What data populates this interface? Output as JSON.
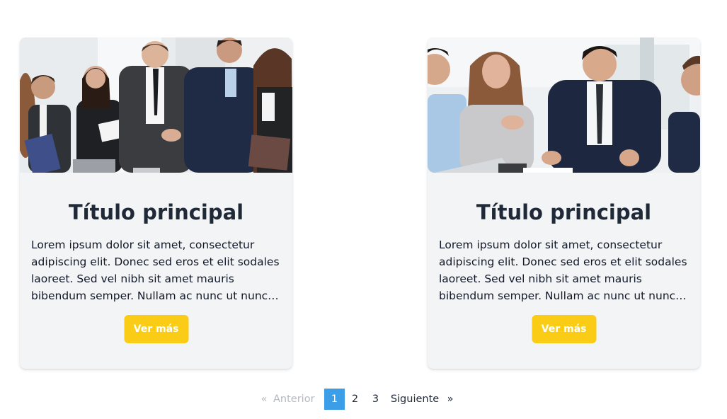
{
  "cards": [
    {
      "title": "Título principal",
      "text": "Lorem ipsum dolor sit amet, consectetur adipiscing elit. Donec sed eros et elit sodales laoreet. Sed vel nibh sit amet mauris bibendum semper. Nullam ac nunc ut nunc eleifend ultricies.",
      "button": "Ver más",
      "image": "business-handshake-photo"
    },
    {
      "title": "Título principal",
      "text": "Lorem ipsum dolor sit amet, consectetur adipiscing elit. Donec sed eros et elit sodales laoreet. Sed vel nibh sit amet mauris bibendum semper. Nullam ac nunc ut nunc eleifend ultricies.",
      "button": "Ver más",
      "image": "business-meeting-photo"
    }
  ],
  "pagination": {
    "prev_arrow": "«",
    "prev_label": "Anterior",
    "pages": [
      "1",
      "2",
      "3"
    ],
    "current_page": "1",
    "next_label": "Siguiente",
    "next_arrow": "»"
  },
  "colors": {
    "card_bg": "#f3f4f6",
    "button_bg": "#facc15",
    "active_page_bg": "#3b9ee6",
    "title": "#1f2937"
  }
}
